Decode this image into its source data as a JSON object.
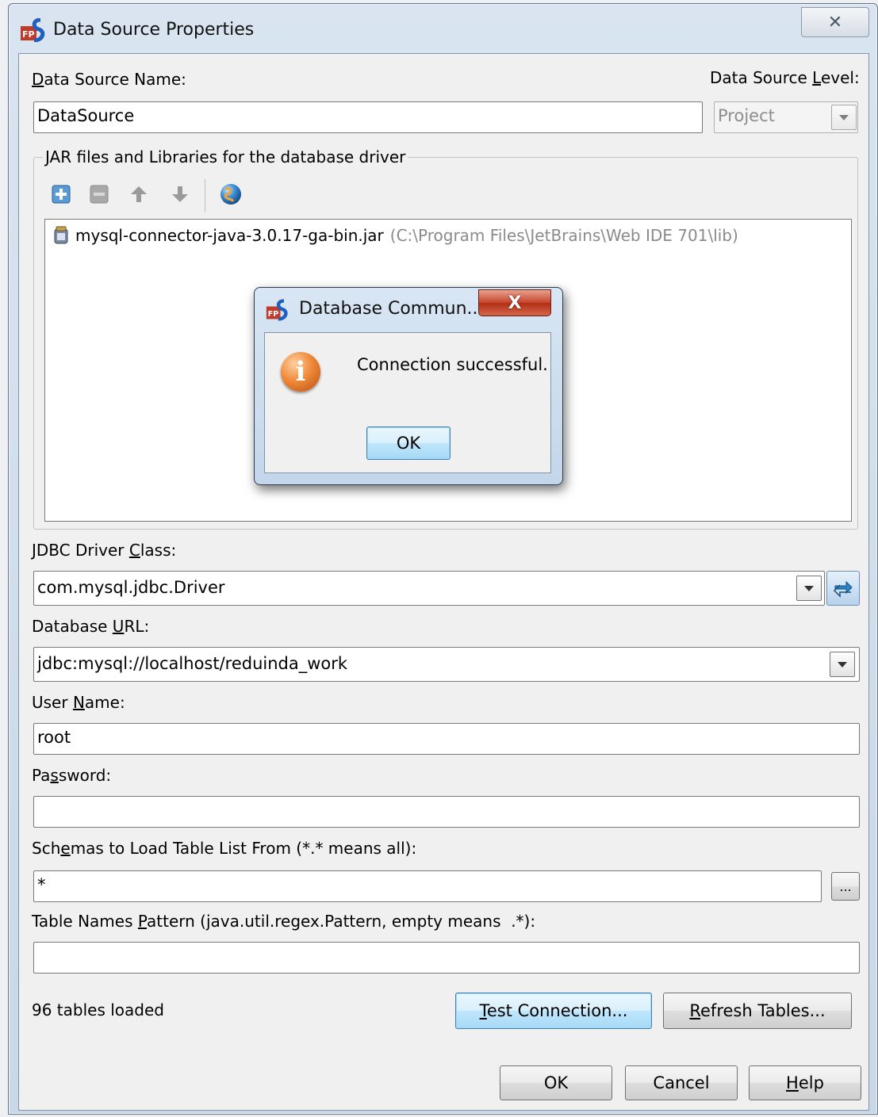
{
  "window": {
    "title": "Data Source Properties",
    "close_glyph": "✕"
  },
  "datasource_name": {
    "label": "Data Source Name:",
    "value": "DataSource"
  },
  "datasource_level": {
    "label": "Data Source Level:",
    "value": "Project"
  },
  "jar_group": {
    "title": "JAR files and Libraries for the database driver",
    "entries": [
      {
        "name": "mysql-connector-java-3.0.17-ga-bin.jar",
        "path": "(C:\\Program Files\\JetBrains\\Web IDE 701\\lib)"
      }
    ]
  },
  "driver_class": {
    "label": "JDBC Driver Class:",
    "value": "com.mysql.jdbc.Driver"
  },
  "database_url": {
    "label": "Database URL:",
    "value": "jdbc:mysql://localhost/reduinda_work"
  },
  "user_name": {
    "label": "User Name:",
    "value": "root"
  },
  "password": {
    "label": "Password:",
    "value": ""
  },
  "schemas": {
    "label": "Schemas to Load Table List From (*.* means all):",
    "value": "*",
    "browse_label": "..."
  },
  "table_pattern": {
    "label": "Table Names Pattern (java.util.regex.Pattern, empty means  .*):",
    "value": ""
  },
  "status": {
    "tables_loaded": "96 tables loaded"
  },
  "buttons": {
    "test_connection": "Test Connection...",
    "refresh_tables": "Refresh Tables...",
    "ok": "OK",
    "cancel": "Cancel",
    "help": "Help"
  },
  "popup": {
    "title": "Database Commun...",
    "message": "Connection successful.",
    "ok": "OK",
    "close_glyph": "X",
    "icon_glyph": "i"
  }
}
